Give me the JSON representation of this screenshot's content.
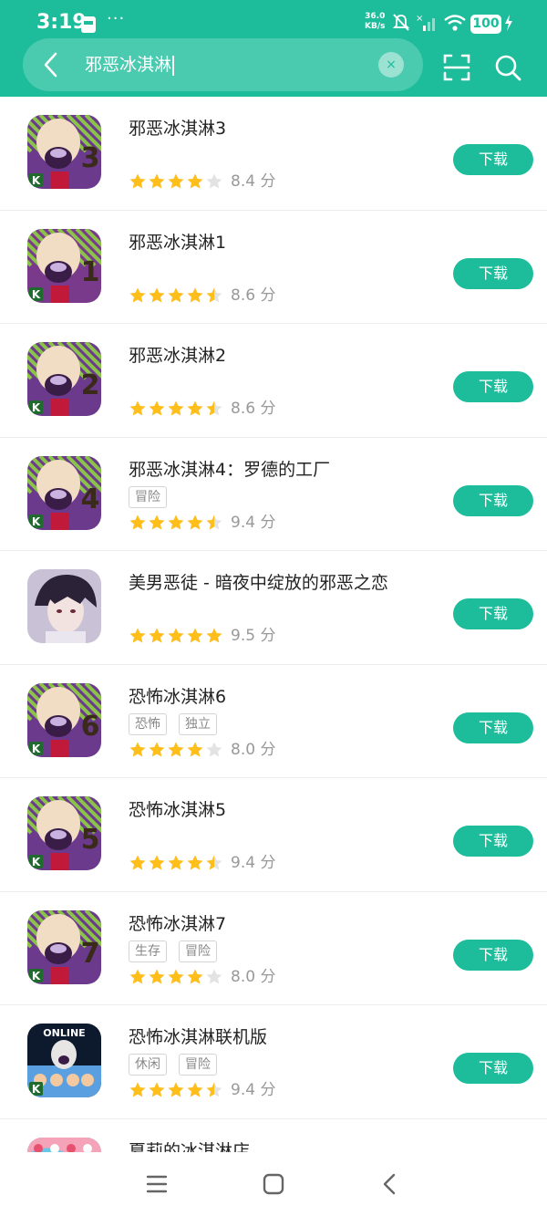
{
  "status_bar": {
    "time": "3:19",
    "more": "···",
    "net_speed_value": "36.0",
    "net_speed_unit": "KB/s",
    "battery": "100"
  },
  "search": {
    "query": "邪恶冰淇淋",
    "clear": "×"
  },
  "download_label": "下载",
  "score_unit": "分",
  "apps": [
    {
      "name": "邪恶冰淇淋3",
      "tags": [],
      "score": "8.4",
      "stars": 4,
      "icon": "ice-scream",
      "number": "3",
      "icon_color": "#6b3a8c",
      "stripe": "#8bc34a"
    },
    {
      "name": "邪恶冰淇淋1",
      "tags": [],
      "score": "8.6",
      "stars": 4.5,
      "icon": "ice-scream",
      "number": "1",
      "icon_color": "#7a3a8c",
      "stripe": "#8bc34a"
    },
    {
      "name": "邪恶冰淇淋2",
      "tags": [],
      "score": "8.6",
      "stars": 4.5,
      "icon": "ice-scream",
      "number": "2",
      "icon_color": "#6b3a8c",
      "stripe": "#8bc34a"
    },
    {
      "name": "邪恶冰淇淋4：罗德的工厂",
      "tags": [
        "冒险"
      ],
      "score": "9.4",
      "stars": 4.5,
      "icon": "ice-scream",
      "number": "4",
      "icon_color": "#6b3a8c",
      "stripe": "#8bc34a"
    },
    {
      "name": "美男恶徒 - 暗夜中绽放的邪恶之恋",
      "tags": [],
      "score": "9.5",
      "stars": 5,
      "icon": "anime-boy",
      "number": "",
      "icon_color": "#c9c2d6",
      "stripe": "#e6e0ee"
    },
    {
      "name": "恐怖冰淇淋6",
      "tags": [
        "恐怖",
        "独立"
      ],
      "score": "8.0",
      "stars": 4,
      "icon": "ice-scream",
      "number": "6",
      "icon_color": "#6b3a8c",
      "stripe": "#8bc34a"
    },
    {
      "name": "恐怖冰淇淋5",
      "tags": [],
      "score": "9.4",
      "stars": 4.5,
      "icon": "ice-scream",
      "number": "5",
      "icon_color": "#6b3a8c",
      "stripe": "#8bc34a"
    },
    {
      "name": "恐怖冰淇淋7",
      "tags": [
        "生存",
        "冒险"
      ],
      "score": "8.0",
      "stars": 4,
      "icon": "ice-scream",
      "number": "7",
      "icon_color": "#6b3a8c",
      "stripe": "#8bc34a"
    },
    {
      "name": "恐怖冰淇淋联机版",
      "tags": [
        "休闲",
        "冒险"
      ],
      "score": "9.4",
      "stars": 4.5,
      "icon": "online",
      "number": "",
      "icon_label": "ONLINE",
      "icon_color": "#2a6fb8",
      "stripe": "#5aa0e0"
    },
    {
      "name": "夏莉的冰淇淋店",
      "tags": [],
      "score": "",
      "stars": 0,
      "icon": "shop",
      "number": "",
      "icon_color": "#67c7e8",
      "stripe": "#f4a3b8"
    }
  ],
  "colors": {
    "accent": "#1dbd9c",
    "star_on": "#ffbe1a",
    "star_off": "#e3e3e3"
  }
}
